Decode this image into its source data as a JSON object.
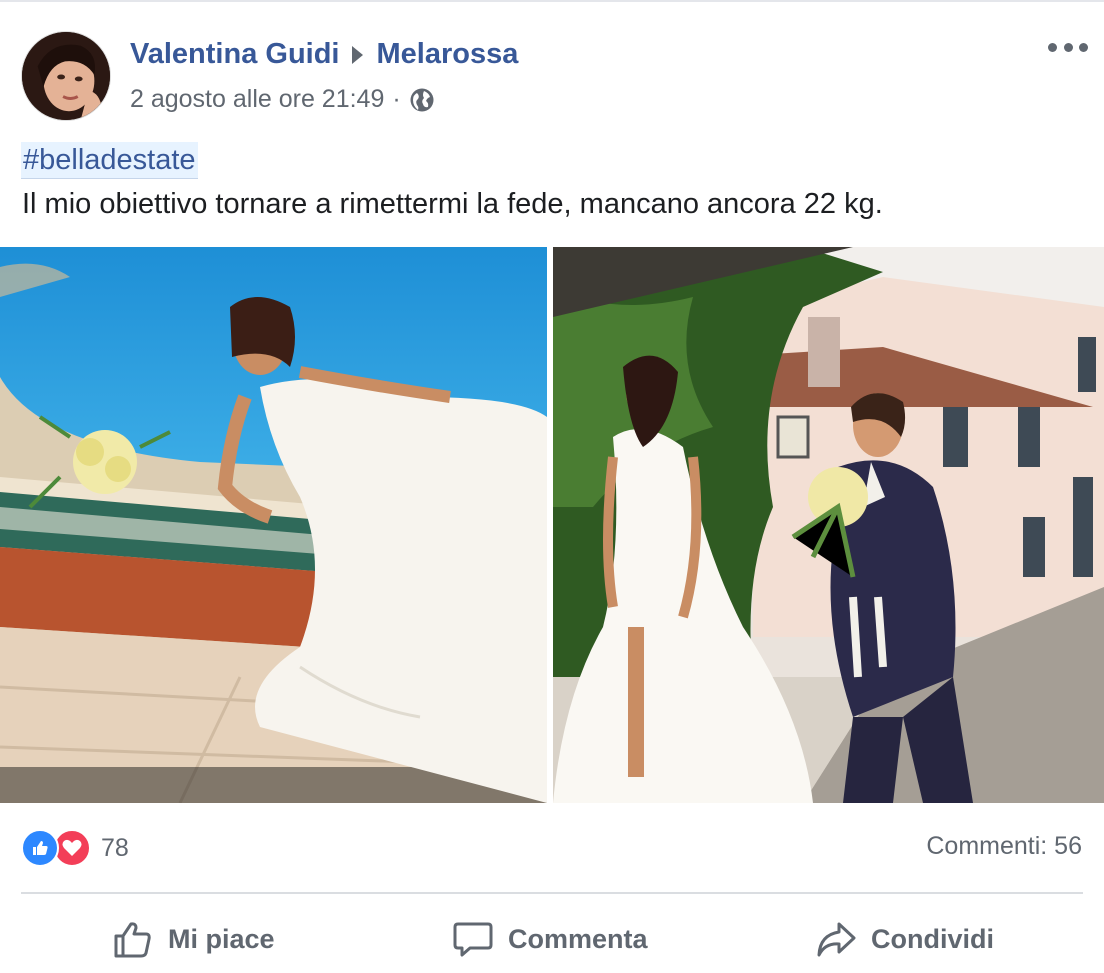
{
  "post": {
    "author": "Valentina Guidi",
    "group": "Melarossa",
    "timestamp": "2 agosto alle ore 21:49",
    "separator": "·",
    "privacy_icon": "globe-icon",
    "menu_icon": "more-options-icon",
    "hashtag": "#belladestate",
    "text": "Il mio obiettivo tornare a rimettermi la fede, mancano ancora 22 kg.",
    "photos": [
      {
        "name": "photo-bride-pool"
      },
      {
        "name": "photo-bride-groom"
      }
    ]
  },
  "stats": {
    "reaction_icons": [
      "like-reaction-icon",
      "love-reaction-icon"
    ],
    "reaction_count": "78",
    "comments": "Commenti: 56"
  },
  "actions": {
    "like": "Mi piace",
    "comment": "Commenta",
    "share": "Condividi"
  },
  "colors": {
    "link": "#385898",
    "secondary_text": "#606770",
    "like_blue": "#2d88ff",
    "love_red": "#f33e58",
    "hashtag_bg": "#e7f3ff"
  }
}
